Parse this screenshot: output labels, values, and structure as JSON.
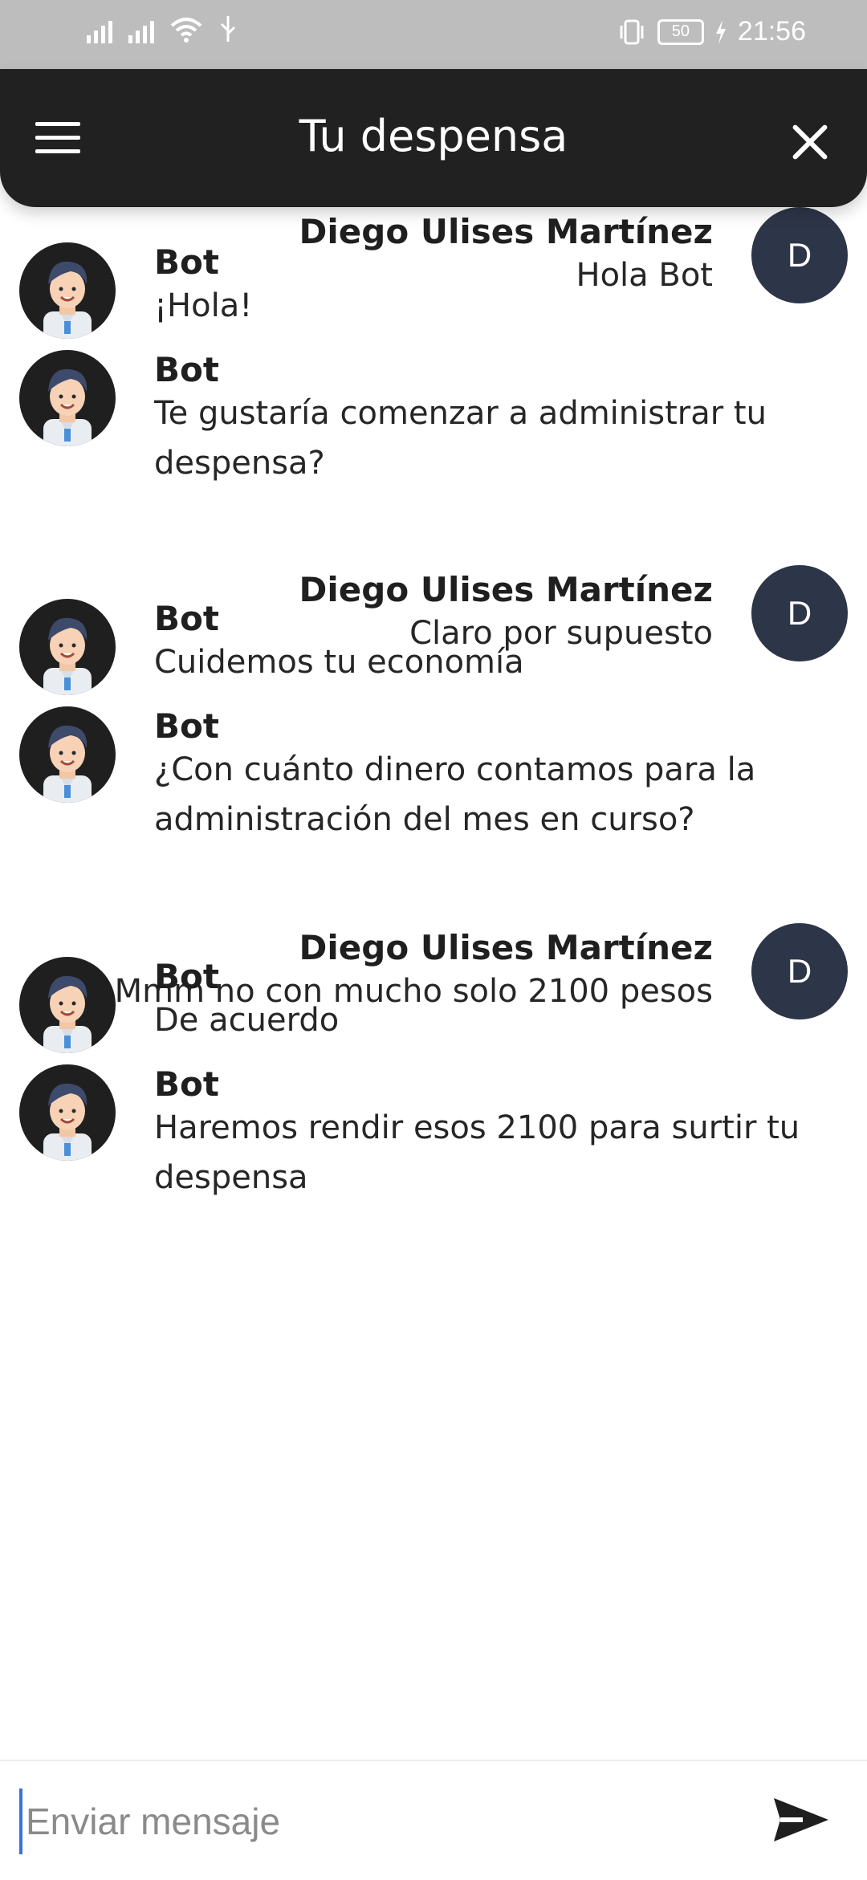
{
  "status": {
    "time": "21:56",
    "battery": "50"
  },
  "header": {
    "title": "Tu despensa"
  },
  "messages": [
    {
      "from": "user",
      "name": "Diego Ulises Martínez",
      "avatar": "D",
      "text": [
        "Hola Bot"
      ]
    },
    {
      "from": "bot",
      "name": "Bot",
      "text": [
        "¡Hola!"
      ]
    },
    {
      "from": "bot",
      "name": "Bot",
      "text": [
        "Te gustaría comenzar a administrar tu",
        "despensa?"
      ]
    },
    {
      "from": "user",
      "name": "Diego Ulises Martínez",
      "avatar": "D",
      "text": [
        "Claro por supuesto"
      ]
    },
    {
      "from": "bot",
      "name": "Bot",
      "text": [
        "Cuidemos tu economía"
      ]
    },
    {
      "from": "bot",
      "name": "Bot",
      "text": [
        "¿Con cuánto dinero contamos para la",
        "administración del mes en curso?"
      ]
    },
    {
      "from": "user",
      "name": "Diego Ulises Martínez",
      "avatar": "D",
      "text": [
        "Mmm no con mucho solo 2100 pesos"
      ]
    },
    {
      "from": "bot",
      "name": "Bot",
      "text": [
        "De acuerdo"
      ]
    },
    {
      "from": "bot",
      "name": "Bot",
      "text": [
        "Haremos rendir esos 2100 para surtir tu",
        "despensa"
      ]
    }
  ],
  "composer": {
    "placeholder": "Enviar mensaje"
  },
  "icons": {
    "menu": "hamburger-menu-icon",
    "close": "close-icon",
    "send": "send-icon",
    "bot_avatar": "bot-avatar-icon"
  }
}
